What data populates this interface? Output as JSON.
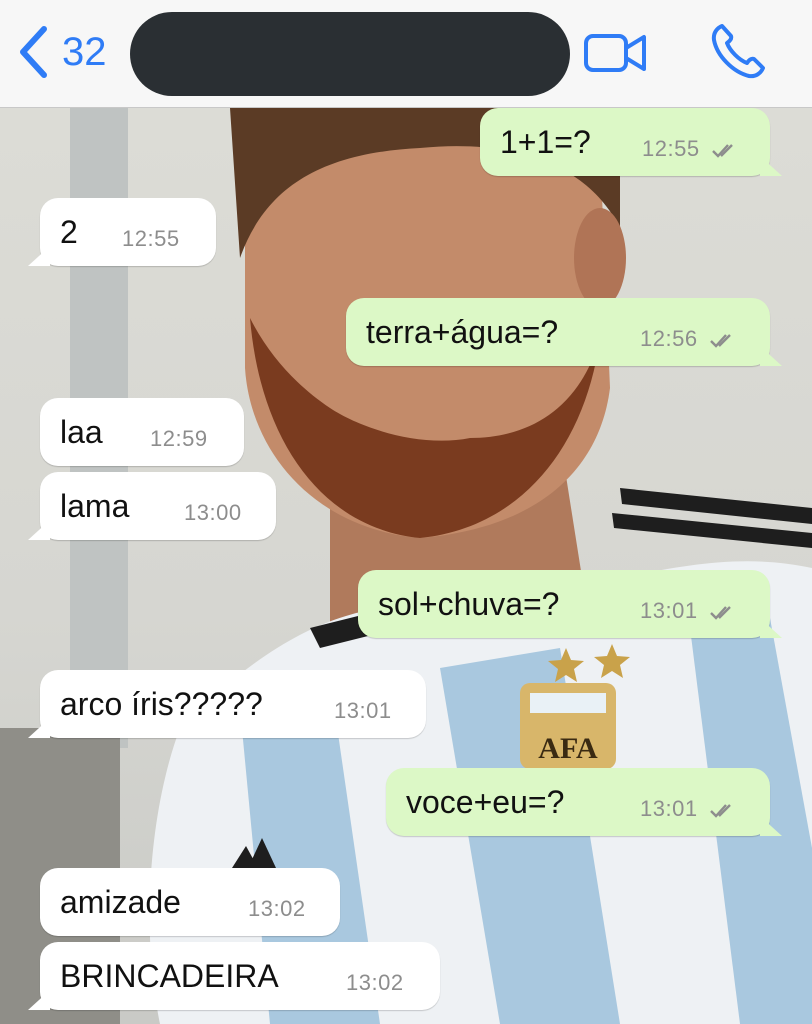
{
  "header": {
    "unread_count": "32",
    "back_icon": "chevron-left-icon",
    "video_icon": "video-camera-icon",
    "call_icon": "phone-icon",
    "accent_color": "#2f7cf6"
  },
  "messages": [
    {
      "direction": "out",
      "text": "1+1=?",
      "time": "12:55",
      "status": "read"
    },
    {
      "direction": "in",
      "text": "2",
      "time": "12:55"
    },
    {
      "direction": "out",
      "text": "terra+água=?",
      "time": "12:56",
      "status": "read"
    },
    {
      "direction": "in",
      "text": "laa",
      "time": "12:59"
    },
    {
      "direction": "in",
      "text": "lama",
      "time": "13:00"
    },
    {
      "direction": "out",
      "text": "sol+chuva=?",
      "time": "13:01",
      "status": "read"
    },
    {
      "direction": "in",
      "text": "arco íris?????",
      "time": "13:01"
    },
    {
      "direction": "out",
      "text": "voce+eu=?",
      "time": "13:01",
      "status": "read"
    },
    {
      "direction": "in",
      "text": "amizade",
      "time": "13:02"
    },
    {
      "direction": "in",
      "text": "BRINCADEIRA",
      "time": "13:02"
    }
  ],
  "colors": {
    "incoming_bubble": "#ffffff",
    "outgoing_bubble": "#dcf8c6",
    "timestamp": "#8d8d8d"
  },
  "background": {
    "crest_text": "AFA"
  }
}
